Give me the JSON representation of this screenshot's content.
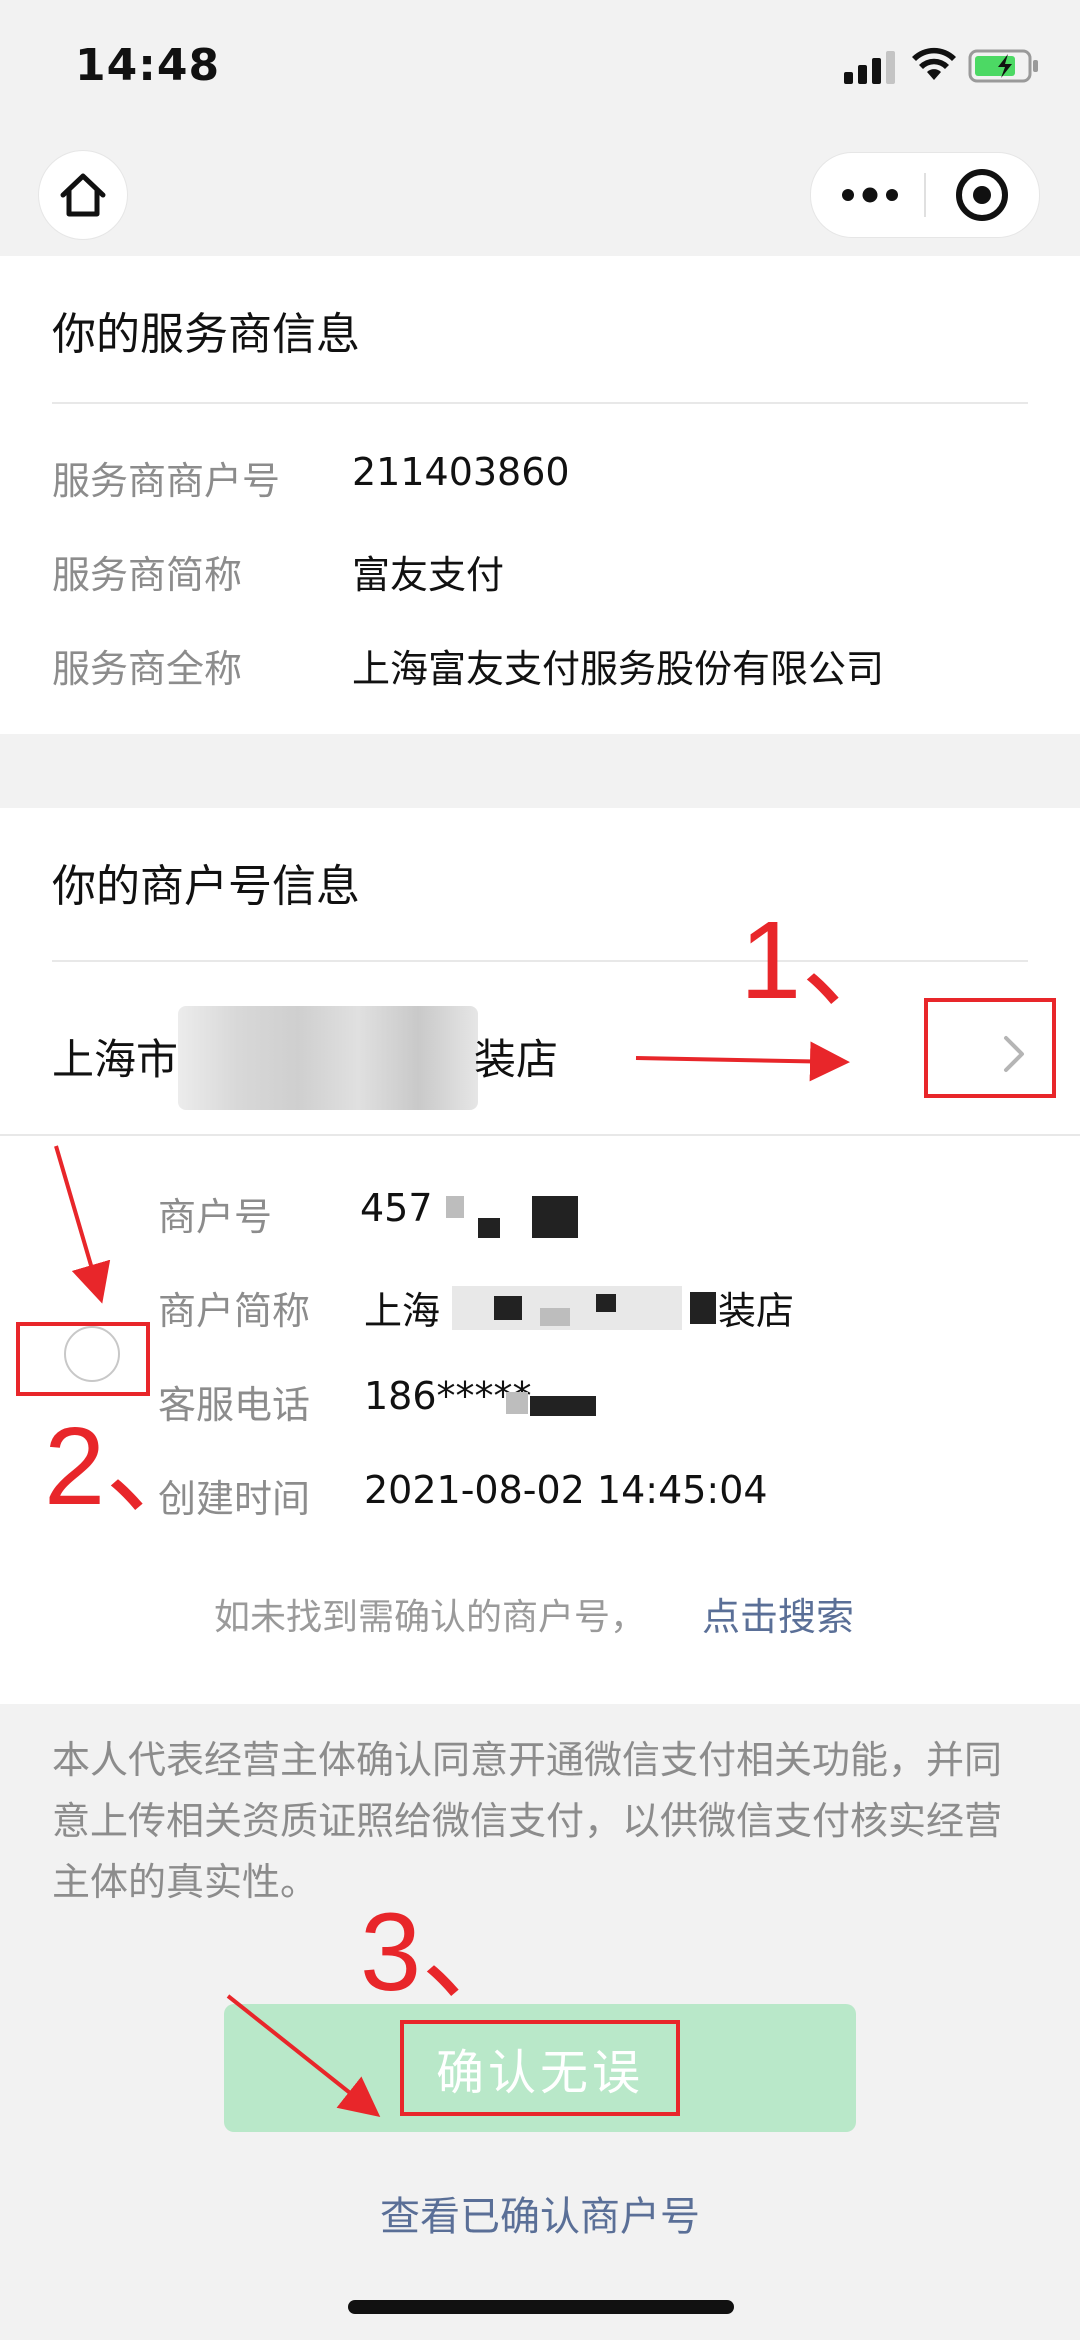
{
  "status_bar": {
    "time": "14:48"
  },
  "service_provider": {
    "title": "你的服务商信息",
    "rows": [
      {
        "label": "服务商商户号",
        "value": "211403860"
      },
      {
        "label": "服务商简称",
        "value": "富友支付"
      },
      {
        "label": "服务商全称",
        "value": "上海富友支付服务股份有限公司"
      }
    ]
  },
  "merchant": {
    "title": "你的商户号信息",
    "name_prefix": "上海市",
    "name_suffix": "装店",
    "rows": [
      {
        "label": "商户号",
        "value": "457"
      },
      {
        "label": "商户简称",
        "value": "上海",
        "value_suffix": "装店"
      },
      {
        "label": "客服电话",
        "value": "186*****"
      },
      {
        "label": "创建时间",
        "value": "2021-08-02 14:45:04"
      }
    ],
    "hint": "如未找到需确认的商户号，",
    "search_link": "点击搜索"
  },
  "agreement_text": "本人代表经营主体确认同意开通微信支付相关功能，并同意上传相关资质证照给微信支付，以供微信支付核实经营主体的真实性。",
  "confirm_button": "确认无误",
  "view_link": "查看已确认商户号",
  "annotations": {
    "step1": "1、",
    "step2": "2、",
    "step3": "3、"
  },
  "colors": {
    "annotation": "#e8262a",
    "link": "#5a6f97",
    "button_disabled": "#b9e8c9"
  }
}
